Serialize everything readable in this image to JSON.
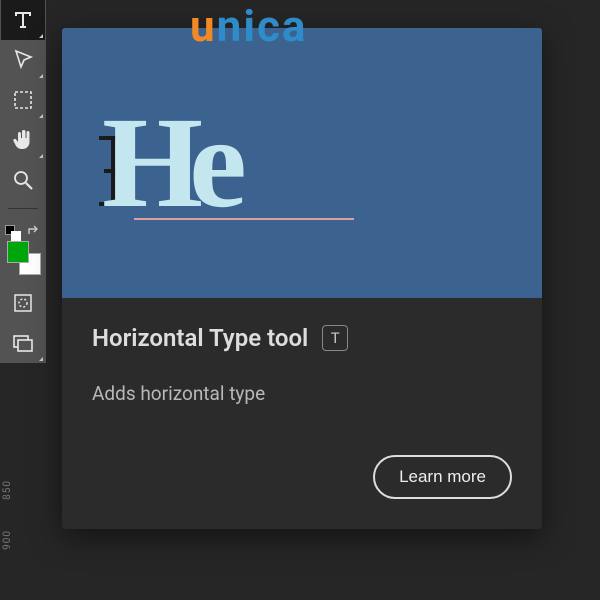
{
  "watermark": {
    "u": "u",
    "n": "n",
    "i": "i",
    "c": "c",
    "a": "a"
  },
  "toolbar": {
    "tools": [
      {
        "name": "type-tool",
        "active": true
      },
      {
        "name": "move-tool",
        "active": false
      },
      {
        "name": "marquee-tool",
        "active": false
      },
      {
        "name": "hand-tool",
        "active": false
      },
      {
        "name": "zoom-tool",
        "active": false
      }
    ],
    "swatch": {
      "fg": "#00a50b",
      "bg": "#ffffff"
    },
    "bottom_tools": [
      {
        "name": "quick-mask-tool"
      },
      {
        "name": "screen-mode-tool"
      }
    ]
  },
  "ruler": {
    "a": "850",
    "b": "900"
  },
  "tooltip": {
    "preview_text": {
      "h": "H",
      "e": "e"
    },
    "title": "Horizontal Type tool",
    "shortcut": "T",
    "description": "Adds horizontal type",
    "learn_more": "Learn more"
  }
}
